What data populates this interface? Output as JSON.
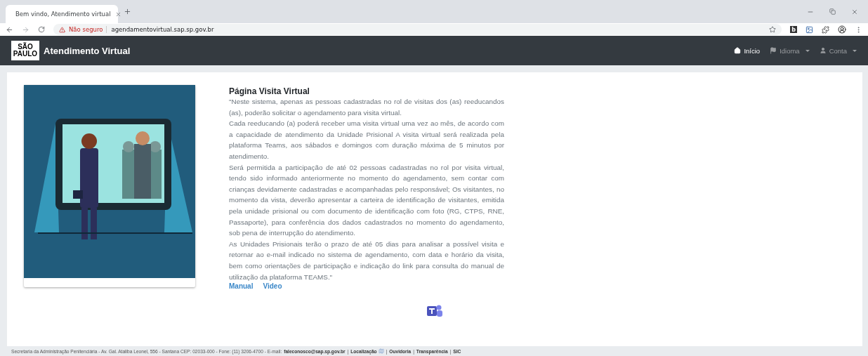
{
  "browser": {
    "tab": {
      "title": "Bem vindo, Atendimento virtual",
      "selected": true
    },
    "address": {
      "warning": "Não seguro",
      "url": "agendamentovirtual.sap.sp.gov.br"
    },
    "extensions": [
      {
        "kind": "letter",
        "label": "b"
      },
      {
        "kind": "image"
      },
      {
        "kind": "puzzle"
      },
      {
        "kind": "profile"
      }
    ]
  },
  "navbar": {
    "logo_text": [
      "SÃO",
      "PAULO"
    ],
    "brand": "Atendimento Virtual",
    "items": [
      {
        "kind": "home",
        "label": "Início",
        "selected": true,
        "dropdown": false
      },
      {
        "kind": "flag",
        "label": "Idioma",
        "selected": false,
        "dropdown": true
      },
      {
        "kind": "user",
        "label": "Conta",
        "selected": false,
        "dropdown": true
      }
    ]
  },
  "content": {
    "title": "Página Visita Virtual",
    "paragraphs": [
      "\"Neste sistema, apenas as pessoas cadastradas no rol de visitas dos (as) reeducandos (as), poderão solicitar o agendamento para visita virtual.",
      "Cada reeducando (a) poderá receber uma visita virtual uma vez ao mês, de acordo com a capacidade de atendimento da Unidade Prisional A visita virtual será realizada pela plataforma Teams, aos sábados e domingos com duração máxima de 5 minutos por atendimento.",
      "Será permitida a participação de até 02 pessoas cadastradas no rol por visita virtual, tendo sido informado anteriormente no momento do agendamento, sem contar com crianças devidamente cadastradas e acompanhadas pelo responsável; Os visitantes, no momento da vista, deverão apresentar a carteira de identificação de visitantes, emitida pela unidade prisional ou com documento de identificação com foto (RG, CTPS, RNE, Passaporte), para conferência dos dados cadastrados no momento do agendamento, sob pena de interrupção do atendimento.",
      "As Unidades Prisionais terão o prazo de até 05 dias para analisar a possível visita e retornar ao e-mail indicado no sistema de agendamento, com data e horário da visita, bem como orientações de participação e indicação do link para consulta do manual de utilização da plataforma TEAMS.\""
    ],
    "links": [
      "Manual",
      "Video"
    ]
  },
  "footer": [
    {
      "kind": "text",
      "text": "Secretaria da Administração Penitenciária - Av. Gal. Ataliba Leonel, 556 - Santana CEP: 02033-000 - Fone: (11) 3206-4700 - E-mail:"
    },
    {
      "kind": "link",
      "text": "faleconosco@sap.sp.gov.br"
    },
    {
      "kind": "separator",
      "text": "|"
    },
    {
      "kind": "map-link",
      "text": "Localização"
    },
    {
      "kind": "separator",
      "text": "|"
    },
    {
      "kind": "link",
      "text": "Ouvidoria"
    },
    {
      "kind": "separator",
      "text": "|"
    },
    {
      "kind": "link",
      "text": "Transparência"
    },
    {
      "kind": "separator",
      "text": "|"
    },
    {
      "kind": "link",
      "text": "SIC"
    }
  ]
}
